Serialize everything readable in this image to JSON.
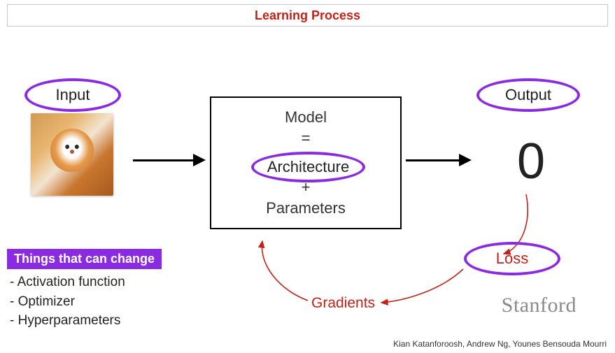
{
  "title": "Learning Process",
  "input_label": "Input",
  "output_label": "Output",
  "output_value": "0",
  "model": {
    "line1": "Model",
    "eq": "=",
    "architecture": "Architecture",
    "plus": "+",
    "parameters": "Parameters"
  },
  "loss_label": "Loss",
  "gradients_label": "Gradients",
  "callout_heading": "Things that can change",
  "bullets": [
    "Activation function",
    "Optimizer",
    "Hyperparameters"
  ],
  "institution": "Stanford",
  "credits": "Kian Katanforoosh, Andrew Ng, Younes Bensouda Mourri",
  "colors": {
    "accent_purple": "#8a2be2",
    "accent_red": "#c22217",
    "stanford_gray": "#8a8a8a"
  }
}
